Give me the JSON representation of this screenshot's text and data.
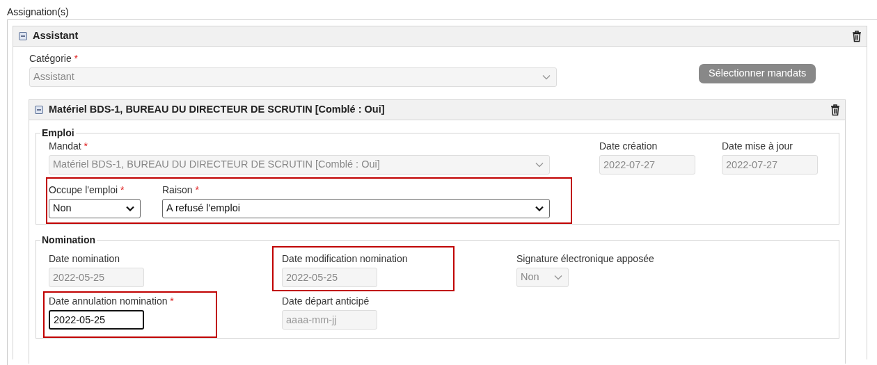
{
  "section_title": "Assignation(s)",
  "assignment": {
    "title": "Assistant",
    "expanded": true,
    "category": {
      "label": "Catégorie",
      "required_mark": "*",
      "kind": "select",
      "value": "Assistant",
      "disabled": true
    },
    "select_button": "Sélectionner mandats",
    "mandate": {
      "title": "Matériel BDS-1, BUREAU DU DIRECTEUR DE SCRUTIN [Comblé : Oui]",
      "expanded": true,
      "fieldsets": [
        {
          "legend": "Emploi",
          "rows": [
            [
              {
                "highlighted": false,
                "fields": [
                  {
                    "label": "Mandat",
                    "required_mark": "*",
                    "kind": "select",
                    "value": "Matériel BDS-1, BUREAU DU DIRECTEUR DE SCRUTIN [Comblé : Oui]",
                    "disabled": true
                  }
                ]
              },
              {
                "highlighted": false,
                "fields": [
                  {
                    "label": "Date création",
                    "kind": "input",
                    "value": "2022-07-27",
                    "disabled": true
                  }
                ]
              },
              {
                "highlighted": false,
                "fields": [
                  {
                    "label": "Date mise à jour",
                    "kind": "input",
                    "value": "2022-07-27",
                    "disabled": true
                  }
                ]
              }
            ],
            [
              {
                "highlighted": true,
                "fields": [
                  {
                    "label": "Occupe l'emploi",
                    "required_mark": "*",
                    "kind": "select",
                    "value": "Non",
                    "disabled": false
                  },
                  {
                    "label": "Raison",
                    "required_mark": "*",
                    "kind": "select",
                    "value": "A refusé l'emploi",
                    "disabled": false
                  }
                ]
              }
            ]
          ]
        },
        {
          "legend": "Nomination",
          "rows": [
            [
              {
                "highlighted": false,
                "fields": [
                  {
                    "label": "Date nomination",
                    "kind": "input",
                    "value": "2022-05-25",
                    "disabled": true
                  }
                ]
              },
              {
                "highlighted": true,
                "fields": [
                  {
                    "label": "Date modification nomination",
                    "kind": "input",
                    "value": "2022-05-25",
                    "disabled": true
                  }
                ]
              },
              {
                "highlighted": false,
                "fields": [
                  {
                    "label": "Signature électronique apposée",
                    "kind": "select",
                    "value": "Non",
                    "disabled": true
                  }
                ]
              }
            ],
            [
              {
                "highlighted": true,
                "fields": [
                  {
                    "label": "Date annulation nomination",
                    "required_mark": "*",
                    "kind": "input",
                    "value": "2022-05-25",
                    "disabled": false,
                    "focused": true
                  }
                ]
              },
              {
                "highlighted": false,
                "fields": [
                  {
                    "label": "Date départ anticipé",
                    "kind": "input",
                    "placeholder": "aaaa-mm-jj",
                    "disabled": true
                  }
                ]
              }
            ]
          ]
        }
      ]
    }
  }
}
